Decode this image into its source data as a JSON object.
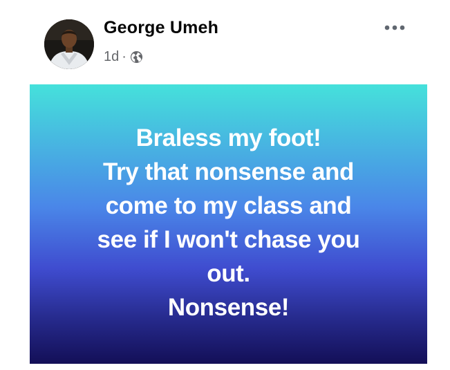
{
  "post": {
    "author": {
      "name": "George Umeh",
      "avatar_icon": "profile-photo"
    },
    "meta": {
      "time": "1d",
      "separator": "·",
      "privacy_icon": "globe-icon"
    },
    "more_icon": "more-options-icon",
    "content": {
      "lines": [
        "Braless my foot!",
        "Try that nonsense and",
        "come to my class and",
        "see if I won't chase you",
        "out.",
        "Nonsense!"
      ],
      "background_colors": [
        "#45e1db",
        "#4a86e8",
        "#3f4ccf",
        "#262a8c",
        "#130f57"
      ],
      "text_color": "#ffffff"
    }
  }
}
